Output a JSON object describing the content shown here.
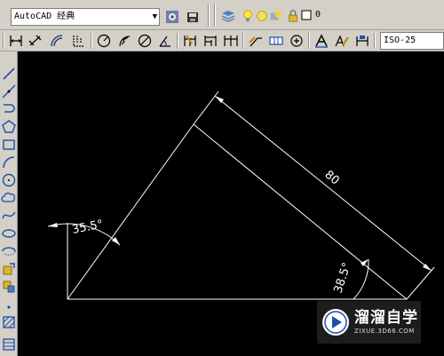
{
  "toolbar_top": {
    "workspace_value": "AutoCAD 经典",
    "layer_value": "0"
  },
  "toolbar_dim": {
    "dimstyle_value": "ISO-25"
  },
  "drawing": {
    "dim_length": "80",
    "angle_left": "35.5°",
    "angle_right": "38.5°",
    "line_color": "#ffffff",
    "background_color": "#000000"
  },
  "watermark": {
    "name": "溜溜自学",
    "url": "ZIXUE.3D66.COM"
  }
}
